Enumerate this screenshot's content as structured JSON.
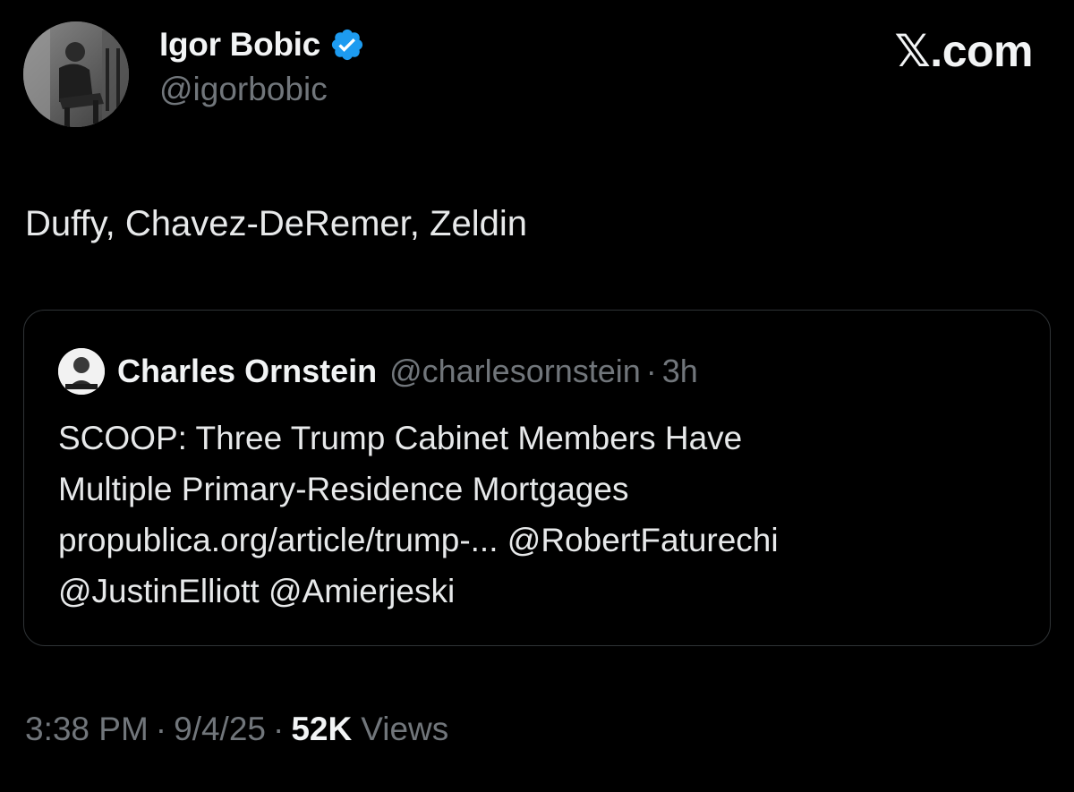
{
  "author": {
    "display_name": "Igor Bobic",
    "handle": "@igorbobic",
    "verified": true,
    "avatar_icon": "profile-photo"
  },
  "brand": {
    "glyph": "𝕏",
    "domain": ".com"
  },
  "tweet": {
    "text": "Duffy, Chavez-DeRemer, Zeldin"
  },
  "quoted_tweet": {
    "display_name": "Charles Ornstein",
    "handle": "@charlesornstein",
    "separator": "·",
    "time": "3h",
    "lines": [
      "SCOOP: Three Trump Cabinet Members Have",
      "Multiple Primary-Residence Mortgages",
      "propublica.org/article/trump-... @RobertFaturechi",
      "@JustinElliott @Amierjeski"
    ]
  },
  "meta": {
    "time": "3:38 PM",
    "separator": "·",
    "date": "9/4/25",
    "views_count": "52K",
    "views_label": "Views"
  },
  "colors": {
    "background": "#000000",
    "text_primary": "#e7e9ea",
    "text_secondary": "#71767b",
    "verified_blue": "#1d9bf0",
    "border": "#2f3336"
  }
}
